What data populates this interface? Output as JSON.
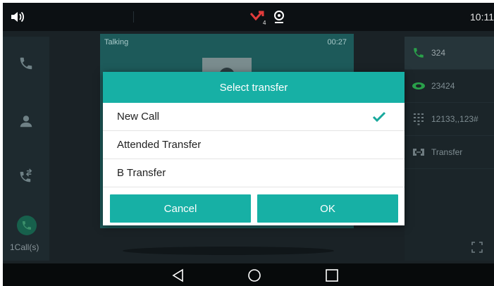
{
  "status_bar": {
    "time": "10:11",
    "missed_count": "4",
    "icons": [
      "volume-icon",
      "missed-call-icon",
      "ring-icon"
    ]
  },
  "left_rail": {
    "items": [
      {
        "icon": "phone-icon"
      },
      {
        "icon": "contacts-icon"
      },
      {
        "icon": "transfer-icon"
      }
    ],
    "calls_count_label": "1Call(s)"
  },
  "call_panel": {
    "status": "Talking",
    "timer": "00:27"
  },
  "right_rail": {
    "lines": [
      {
        "label": "324",
        "icon": "handset-icon"
      },
      {
        "label": "23424",
        "icon": "handset-green-icon"
      },
      {
        "label": "12133,,123#",
        "icon": "dialpad-icon"
      },
      {
        "label": "Transfer",
        "icon": "transfer-key-icon"
      }
    ]
  },
  "dialog": {
    "title": "Select transfer",
    "options": [
      {
        "label": "New Call",
        "selected": true
      },
      {
        "label": "Attended Transfer",
        "selected": false
      },
      {
        "label": "B Transfer",
        "selected": false
      }
    ],
    "cancel_label": "Cancel",
    "ok_label": "OK"
  },
  "nav": {
    "buttons": [
      "back-icon",
      "home-icon",
      "recents-icon"
    ]
  },
  "colors": {
    "accent": "#17b0a5",
    "missed": "#e23b3b",
    "call_green": "#2aa04a"
  }
}
